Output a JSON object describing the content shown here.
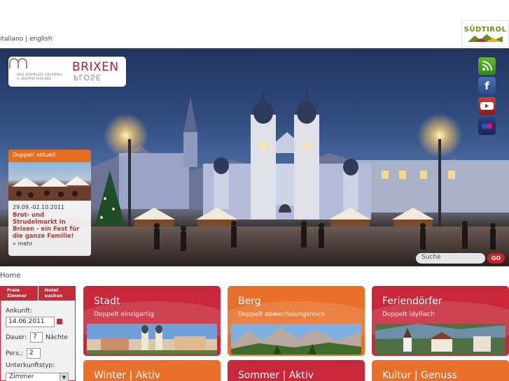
{
  "lang": {
    "italiano": "italiano",
    "separator": "|",
    "english": "english"
  },
  "brand": {
    "suedtirol": "SÜDTIROL"
  },
  "logo": {
    "main": "BRIXEN",
    "mirror": "PLOSE",
    "tagline1": "DAS DOPPELTE ERLEBNIS",
    "tagline2": "IL DOPPIO PIACERE"
  },
  "social": {
    "rss": "rss-icon",
    "facebook": "facebook-icon",
    "youtube": "youtube-icon",
    "flickr": "flickr-icon"
  },
  "news": {
    "header": "Doppelt aktuell",
    "date": "29.09.-02.10.2011",
    "title": "Brot- und Strudelmarkt in Brixen - ein Fest für die ganze Familie!",
    "more": "» mehr"
  },
  "search": {
    "placeholder": "Suche",
    "button": "GO"
  },
  "breadcrumb": "Home",
  "booking": {
    "tab_free": "Freie Zimmer",
    "tab_hotel": "Hotel suchen",
    "arrival_label": "Ankunft:",
    "arrival_value": "14.06.2011",
    "duration_label": "Dauer:",
    "duration_value": "7",
    "nights_label": "Nächte",
    "persons_label": "Pers.:",
    "persons_value": "2",
    "type_label": "Unterkunftstyp:",
    "type_value": "Zimmer"
  },
  "tiles": [
    {
      "title": "Stadt",
      "subtitle": "Doppelt einzigartig"
    },
    {
      "title": "Berg",
      "subtitle": "Doppelt abwechslungsreich"
    },
    {
      "title": "Feriendörfer",
      "subtitle": "Doppelt idyllisch"
    },
    {
      "title": "Winter | Aktiv",
      "subtitle": ""
    },
    {
      "title": "Sommer | Aktiv",
      "subtitle": ""
    },
    {
      "title": "Kultur | Genuss",
      "subtitle": ""
    }
  ],
  "colors": {
    "red": "#c8283a",
    "orange": "#e8702a",
    "sky": "#2f4a7c"
  }
}
